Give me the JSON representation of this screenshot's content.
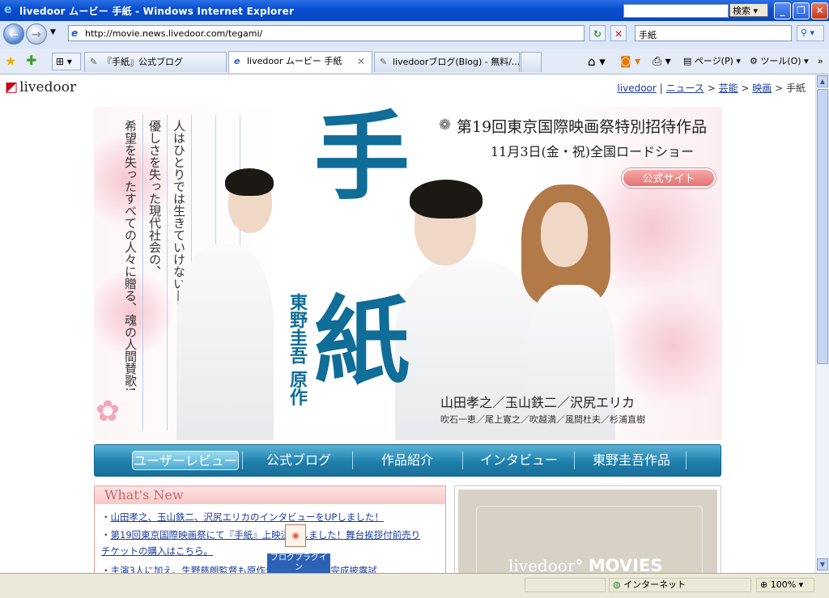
{
  "window": {
    "title": "livedoor ムービー  手紙 - Windows Internet Explorer",
    "search_btn": "検索"
  },
  "address": {
    "url": "http://movie.news.livedoor.com/tegami/",
    "search_value": "手紙"
  },
  "tabs": [
    {
      "label": "『手紙』公式ブログ"
    },
    {
      "label": "livedoor ムービー  手紙"
    },
    {
      "label": "livedoorブログ(Blog) - 無料/..."
    }
  ],
  "commands": {
    "page": "ページ(P)",
    "tools": "ツール(O)"
  },
  "page": {
    "logo": "livedoor",
    "breadcrumb": {
      "home": "livedoor",
      "news": "ニュース",
      "entertainment": "芸能",
      "movies": "映画",
      "current": "手紙",
      "sep1": " | ",
      "sep2": " > "
    },
    "poster": {
      "title_1": "手",
      "title_2": "紙",
      "author": "東野圭吾  原作",
      "tagline_1": "人はひとりでは生きていけない——。",
      "tagline_2": "優しさを失った現代社会の、",
      "tagline_3": "希望を失ったすべての人々に贈る、魂の人間賛歌!",
      "festival": "第19回東京国際映画祭特別招待作品",
      "release": "11月3日(金・祝)全国ロードショー",
      "official_site": "公式サイト",
      "cast": "山田孝之／玉山鉄二／沢尻エリカ",
      "subcast": "吹石一恵／尾上寛之／吹越満／風間杜夫／杉浦直樹"
    },
    "nav": [
      {
        "label": "ユーザーレビュー"
      },
      {
        "label": "公式ブログ"
      },
      {
        "label": "作品紹介"
      },
      {
        "label": "インタビュー"
      },
      {
        "label": "東野圭吾作品"
      }
    ],
    "whats_new": {
      "title": "What's New",
      "items": [
        "山田孝之、玉山鉄二、沢尻エリカのインタビューをUPしました！",
        "第19回東京国際映画祭にて『手紙』上映決定しました！舞台挨拶付前売り",
        "チケットの購入はこちら。",
        "主演3人に加え、生野慈朗監督も原作企画も参加した完成披露試"
      ]
    },
    "movies_logo": "livedoor",
    "movies_logo_bold": "MOVIES",
    "blog_plugin": "ブログプラグイン"
  },
  "status": {
    "zone": "インターネット",
    "zoom": "100%"
  }
}
